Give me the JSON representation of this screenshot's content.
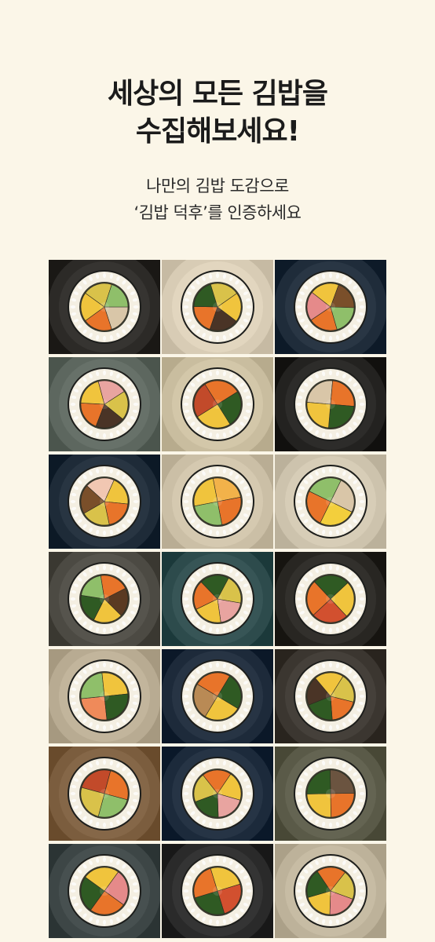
{
  "hero": {
    "headline_line1": "세상의 모든 김밥을",
    "headline_line2": "수집해보세요!",
    "sub_line1": "나만의 김밥 도감으로",
    "sub_line2": "‘김밥 덕후’를 인증하세요"
  },
  "colors": {
    "page_background": "#fbf6e8",
    "rice": "#f4efe2",
    "seaweed": "#1c1d1b",
    "carrot": "#e8742a",
    "spinach": "#2f5a23",
    "egg": "#f0c43d",
    "radish": "#d9c24a",
    "crab": "#e58a8a"
  },
  "gallery": {
    "tiles": [
      {
        "plate": "#2c2a27",
        "fillings": [
          "tuna",
          "carrot",
          "egg",
          "radish",
          "cucumber"
        ]
      },
      {
        "plate": "#d8ccb5",
        "fillings": [
          "beef",
          "carrot",
          "spinach",
          "radish",
          "egg"
        ]
      },
      {
        "plate": "#1f2c3a",
        "fillings": [
          "carrot",
          "crab",
          "egg",
          "burdock",
          "cucumber"
        ]
      },
      {
        "plate": "#5d675f",
        "fillings": [
          "carrot",
          "egg",
          "ham",
          "radish",
          "beef"
        ]
      },
      {
        "plate": "#c9bd9f",
        "fillings": [
          "spicy-pork",
          "carrot",
          "spinach",
          "egg"
        ]
      },
      {
        "plate": "#232220",
        "fillings": [
          "tuna",
          "carrot",
          "spinach",
          "egg"
        ]
      },
      {
        "plate": "#1e2b38",
        "fillings": [
          "shrimp",
          "egg",
          "carrot",
          "radish",
          "burdock"
        ]
      },
      {
        "plate": "#cbbfa6",
        "fillings": [
          "cheese",
          "carrot",
          "cucumber",
          "egg"
        ]
      },
      {
        "plate": "#cdc3ad",
        "fillings": [
          "tuna",
          "corn",
          "carrot",
          "cucumber"
        ]
      },
      {
        "plate": "#4c4a43",
        "fillings": [
          "bulgogi",
          "egg",
          "spinach",
          "cucumber",
          "carrot"
        ]
      },
      {
        "plate": "#2d4b4c",
        "fillings": [
          "ham",
          "egg",
          "carrot",
          "spinach",
          "radish"
        ]
      },
      {
        "plate": "#282622",
        "fillings": [
          "kimchi",
          "carrot",
          "spinach",
          "egg"
        ]
      },
      {
        "plate": "#b8ab92",
        "fillings": [
          "salmon",
          "cucumber",
          "egg",
          "spinach"
        ]
      },
      {
        "plate": "#1d2a3a",
        "fillings": [
          "chicken",
          "carrot",
          "spinach",
          "egg"
        ]
      },
      {
        "plate": "#3b3630",
        "fillings": [
          "beef",
          "egg",
          "radish",
          "carrot",
          "spinach"
        ]
      },
      {
        "plate": "#7b5d3e",
        "fillings": [
          "spicy-pork",
          "carrot",
          "cucumber",
          "radish"
        ]
      },
      {
        "plate": "#1c2a3b",
        "fillings": [
          "carrot",
          "egg",
          "ham",
          "spinach",
          "radish"
        ]
      },
      {
        "plate": "#5a5a48",
        "fillings": [
          "mushroom",
          "carrot",
          "egg",
          "spinach"
        ]
      },
      {
        "plate": "#3d4646",
        "fillings": [
          "crab",
          "carrot",
          "spinach",
          "egg"
        ]
      },
      {
        "plate": "#2a2a2a",
        "fillings": [
          "kimchi",
          "spinach",
          "carrot",
          "egg"
        ]
      },
      {
        "plate": "#bdb29a",
        "fillings": [
          "crab",
          "egg",
          "spinach",
          "carrot",
          "radish"
        ]
      }
    ]
  }
}
